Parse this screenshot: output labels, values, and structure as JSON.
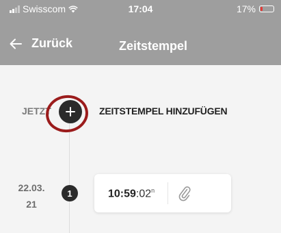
{
  "status_bar": {
    "carrier": "Swisscom",
    "time": "17:04",
    "battery": "17%",
    "battery_color": "#e53935"
  },
  "nav": {
    "back_label": "Zurück",
    "title": "Zeitstempel"
  },
  "add_row": {
    "now_label": "JETZT",
    "action_label": "ZEITSTEMPEL HINZUFÜGEN",
    "icon": "plus-icon"
  },
  "entries": [
    {
      "date_line1": "22.03.",
      "date_line2": "21",
      "number": "1",
      "time_hm": "10:59",
      "time_sec": ":02",
      "time_sup": "n",
      "icon": "paperclip-icon"
    }
  ],
  "colors": {
    "header_bg": "#9e9e9e",
    "annotation_ring": "#9b1c1c",
    "circle_dark": "#2b2b2b"
  }
}
